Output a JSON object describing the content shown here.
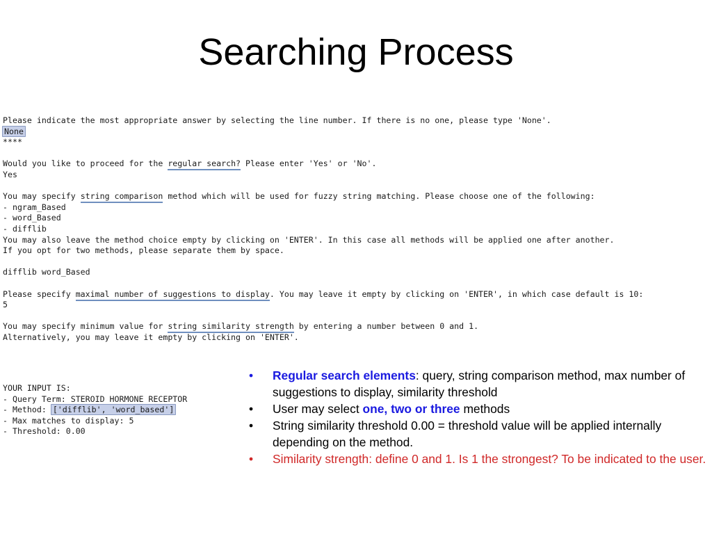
{
  "slide": {
    "title": "Searching Process"
  },
  "console": {
    "lines": [
      {
        "segments": [
          {
            "text": "Please indicate the most appropriate answer by selecting the line number. If there is no one, please type 'None'.",
            "style": "plain"
          }
        ]
      },
      {
        "segments": [
          {
            "text": "None",
            "style": "highlight"
          }
        ]
      },
      {
        "segments": [
          {
            "text": "****",
            "style": "plain"
          }
        ]
      },
      {
        "segments": [
          {
            "text": "",
            "style": "plain"
          }
        ]
      },
      {
        "segments": [
          {
            "text": "Would you like to proceed for the ",
            "style": "plain"
          },
          {
            "text": "regular search?",
            "style": "underline"
          },
          {
            "text": " Please enter 'Yes' or 'No'.",
            "style": "plain"
          }
        ]
      },
      {
        "segments": [
          {
            "text": "Yes",
            "style": "plain"
          }
        ]
      },
      {
        "segments": [
          {
            "text": "",
            "style": "plain"
          }
        ]
      },
      {
        "segments": [
          {
            "text": "You may specify ",
            "style": "plain"
          },
          {
            "text": "string comparison",
            "style": "underline"
          },
          {
            "text": " method which will be used for fuzzy string matching. Please choose one of the following:",
            "style": "plain"
          }
        ]
      },
      {
        "segments": [
          {
            "text": "- ngram_Based",
            "style": "plain"
          }
        ]
      },
      {
        "segments": [
          {
            "text": "- word_Based",
            "style": "plain"
          }
        ]
      },
      {
        "segments": [
          {
            "text": "- difflib",
            "style": "plain"
          }
        ]
      },
      {
        "segments": [
          {
            "text": "You may also leave the method choice empty by clicking on 'ENTER'. In this case all methods will be applied one after another.",
            "style": "plain"
          }
        ]
      },
      {
        "segments": [
          {
            "text": "If you opt for two methods, please separate them by space.",
            "style": "plain"
          }
        ]
      },
      {
        "segments": [
          {
            "text": "",
            "style": "plain"
          }
        ]
      },
      {
        "segments": [
          {
            "text": "difflib word_Based",
            "style": "plain"
          }
        ]
      },
      {
        "segments": [
          {
            "text": "",
            "style": "plain"
          }
        ]
      },
      {
        "segments": [
          {
            "text": "Please specify ",
            "style": "plain"
          },
          {
            "text": "maximal number of suggestions to display",
            "style": "underline"
          },
          {
            "text": ". You may leave it empty by clicking on 'ENTER', in which case default is 10:",
            "style": "plain"
          }
        ]
      },
      {
        "segments": [
          {
            "text": "5",
            "style": "plain"
          }
        ]
      },
      {
        "segments": [
          {
            "text": "",
            "style": "plain"
          }
        ]
      },
      {
        "segments": [
          {
            "text": "You may specify minimum value for ",
            "style": "plain"
          },
          {
            "text": "string similarity strength",
            "style": "underline"
          },
          {
            "text": " by entering a number between 0 and 1.",
            "style": "plain"
          }
        ]
      },
      {
        "segments": [
          {
            "text": "Alternatively, you may leave it empty by clicking on 'ENTER'.",
            "style": "plain"
          }
        ]
      }
    ]
  },
  "input_block": {
    "lines": [
      {
        "segments": [
          {
            "text": "YOUR INPUT IS:",
            "style": "plain"
          }
        ]
      },
      {
        "segments": [
          {
            "text": "- Query Term: STEROID HORMONE RECEPTOR",
            "style": "plain"
          }
        ]
      },
      {
        "segments": [
          {
            "text": "- Method: ",
            "style": "plain"
          },
          {
            "text": "['difflib', 'word_based']",
            "style": "highlight"
          }
        ]
      },
      {
        "segments": [
          {
            "text": "- Max matches to display: 5",
            "style": "plain"
          }
        ]
      },
      {
        "segments": [
          {
            "text": "- Threshold: 0.00",
            "style": "plain"
          }
        ]
      }
    ]
  },
  "bullets": {
    "items": [
      {
        "dot_color": "blue",
        "segments": [
          {
            "text": "Regular search elements",
            "style": "blue-bold"
          },
          {
            "text": ": query, string comparison method, max number of suggestions to display, similarity threshold",
            "style": "plain"
          }
        ]
      },
      {
        "dot_color": "black",
        "segments": [
          {
            "text": "User may select ",
            "style": "plain"
          },
          {
            "text": "one, two or three",
            "style": "blue-bold"
          },
          {
            "text": " methods",
            "style": "plain"
          }
        ]
      },
      {
        "dot_color": "black",
        "segments": [
          {
            "text": "String similarity threshold 0.00 = threshold value will be applied internally depending on the method.",
            "style": "plain"
          }
        ]
      },
      {
        "dot_color": "red",
        "segments": [
          {
            "text": "Similarity strength: define 0 and 1. Is 1 the strongest? To be indicated to the user.",
            "style": "red"
          }
        ]
      }
    ],
    "dot_glyph": "•"
  },
  "colors": {
    "accent_blue": "#1a1ae0",
    "accent_red": "#d02828",
    "highlight_fill": "#c6cfe8",
    "highlight_border": "#8a9ac0",
    "underline": "#6f8fbf",
    "text": "#000000",
    "background": "#ffffff"
  }
}
